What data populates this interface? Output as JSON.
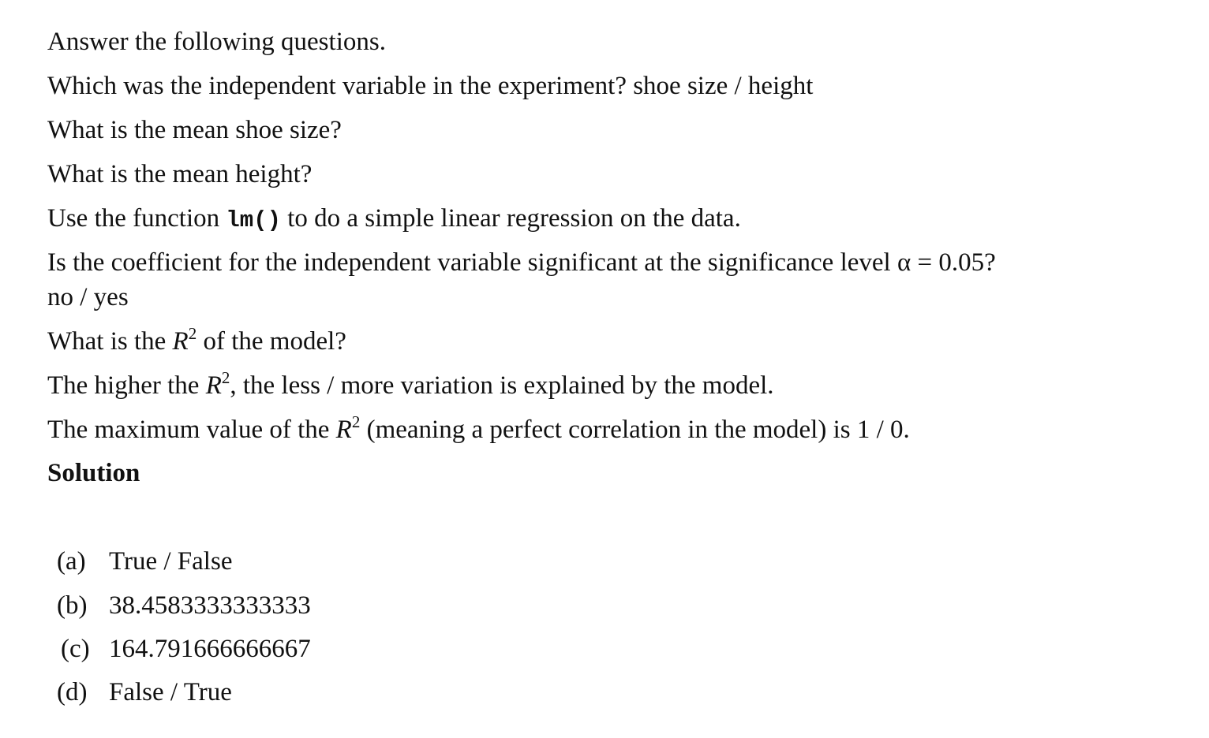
{
  "questions": {
    "intro": "Answer the following questions.",
    "q1_text": "Which was the independent variable in the experiment?",
    "q1_options": "shoe size / height",
    "q2": "What is the mean shoe size?",
    "q3": "What is the mean height?",
    "q4_pre": "Use the function",
    "q4_code": "lm()",
    "q4_post": "to do a simple linear regression on the data.",
    "q5_text": "Is the coefficient for the independent variable significant at the significance level",
    "q5_symbol": "α = 0.05?",
    "q5_options": "no / yes",
    "q6_pre": "What is the",
    "q6_r": "R",
    "q6_sup": "2",
    "q6_post": "of the model?",
    "q7_pre": "The higher the",
    "q7_r": "R",
    "q7_sup": "2",
    "q7_post": ", the less / more variation is explained by the model.",
    "q8_pre": "The maximum value of the",
    "q8_r": "R",
    "q8_sup": "2",
    "q8_post": "(meaning a perfect correlation in the model) is 1 / 0."
  },
  "solution": {
    "heading": "Solution",
    "items": [
      {
        "label": "(a)",
        "value": "True / False"
      },
      {
        "label": "(b)",
        "value": "38.4583333333333"
      },
      {
        "label": "(c)",
        "value": "164.791666666667"
      },
      {
        "label": "(d)",
        "value": "False / True"
      }
    ]
  }
}
